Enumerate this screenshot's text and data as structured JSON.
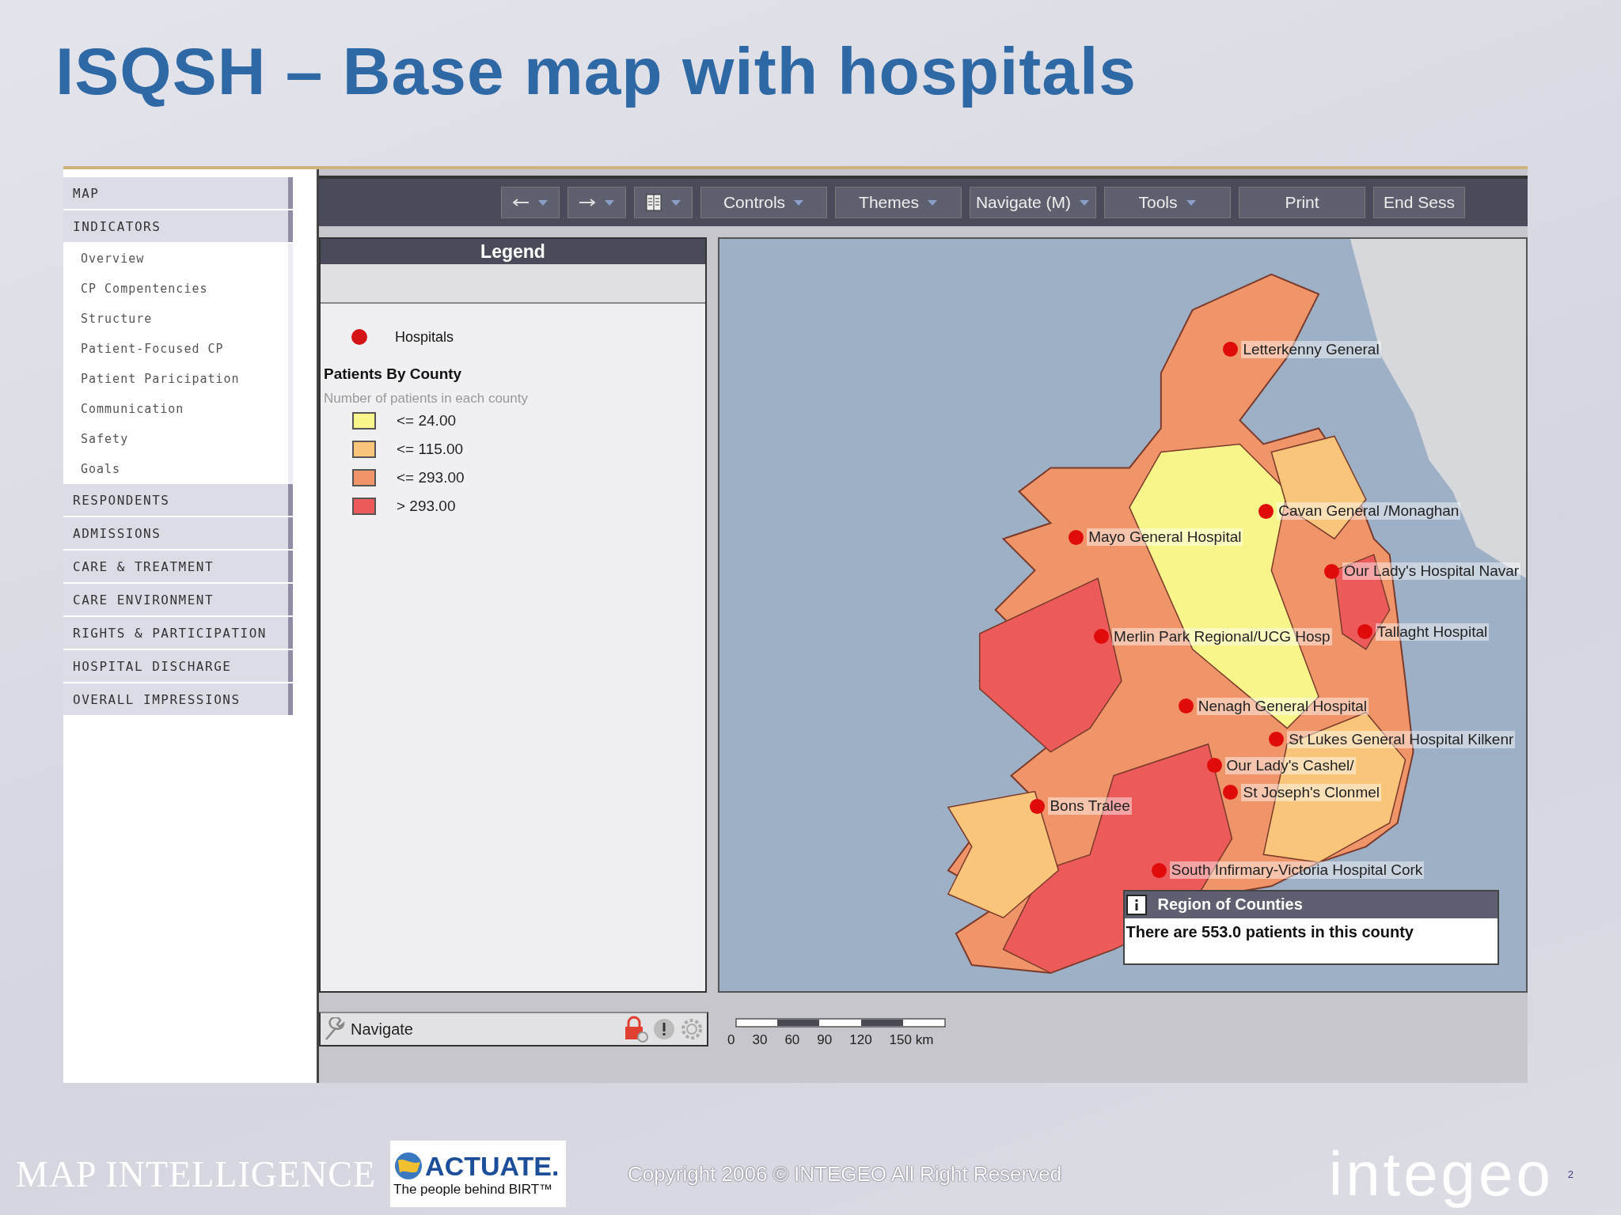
{
  "title": "ISQSH – Base map with hospitals",
  "sidebar": {
    "items": [
      {
        "label": "MAP",
        "kind": "section"
      },
      {
        "label": "INDICATORS",
        "kind": "section"
      },
      {
        "label": "Overview",
        "kind": "sub"
      },
      {
        "label": "CP Compentencies",
        "kind": "sub"
      },
      {
        "label": "Structure",
        "kind": "sub"
      },
      {
        "label": "Patient-Focused CP",
        "kind": "sub"
      },
      {
        "label": "Patient Paricipation",
        "kind": "sub"
      },
      {
        "label": "Communication",
        "kind": "sub"
      },
      {
        "label": "Safety",
        "kind": "sub"
      },
      {
        "label": "Goals",
        "kind": "sub"
      },
      {
        "label": "RESPONDENTS",
        "kind": "section"
      },
      {
        "label": "ADMISSIONS",
        "kind": "section"
      },
      {
        "label": "CARE & TREATMENT",
        "kind": "section"
      },
      {
        "label": "CARE ENVIRONMENT",
        "kind": "section"
      },
      {
        "label": "RIGHTS & PARTICIPATION",
        "kind": "section"
      },
      {
        "label": "HOSPITAL DISCHARGE",
        "kind": "section"
      },
      {
        "label": "OVERALL IMPRESSIONS",
        "kind": "section"
      }
    ]
  },
  "toolbar": [
    {
      "kind": "back"
    },
    {
      "kind": "forward"
    },
    {
      "kind": "book"
    },
    {
      "kind": "menu",
      "label": "Controls"
    },
    {
      "kind": "menu",
      "label": "Themes"
    },
    {
      "kind": "menu",
      "label": "Navigate (M)"
    },
    {
      "kind": "menu",
      "label": "Tools"
    },
    {
      "kind": "button",
      "label": "Print"
    },
    {
      "kind": "button",
      "label": "End Sess"
    }
  ],
  "legend": {
    "title": "Legend",
    "point_layer": "Hospitals",
    "theme_title": "Patients By County",
    "theme_subtitle": "Number of patients in each county",
    "classes": [
      {
        "label": "<= 24.00",
        "color": "#f8f68a"
      },
      {
        "label": "<= 115.00",
        "color": "#f8c57a"
      },
      {
        "label": "<= 293.00",
        "color": "#f0946a"
      },
      {
        "label": "> 293.00",
        "color": "#ec5a5a"
      }
    ]
  },
  "map": {
    "hospitals": [
      {
        "label": "Letterkenny General"
      },
      {
        "label": "Cavan General /Monaghan"
      },
      {
        "label": "Mayo General Hospital"
      },
      {
        "label": "Our Lady's Hospital Navar"
      },
      {
        "label": "Merlin Park Regional/UCG Hosp"
      },
      {
        "label": "Tallaght Hospital"
      },
      {
        "label": "Nenagh General Hospital"
      },
      {
        "label": "St Lukes General Hospital Kilkenr"
      },
      {
        "label": "Our Lady's Cashel/"
      },
      {
        "label": "St Joseph's Clonmel"
      },
      {
        "label": "Bons Tralee"
      },
      {
        "label": "South Infirmary-Victoria Hospital Cork"
      }
    ],
    "info": {
      "title": "Region of Counties",
      "text": "There are 553.0 patients in this county"
    }
  },
  "status": {
    "mode": "Navigate"
  },
  "scale": {
    "labels": [
      "0",
      "30",
      "60",
      "90",
      "120",
      "150 km"
    ]
  },
  "footer": {
    "brand": "MAP INTELLIGENCE",
    "partner": "ACTUATE.",
    "partner_tagline": "The people behind BIRT™",
    "copyright": "Copyright 2006 © INTEGEO All Right Reserved",
    "logo": "integeo",
    "page": "2"
  }
}
